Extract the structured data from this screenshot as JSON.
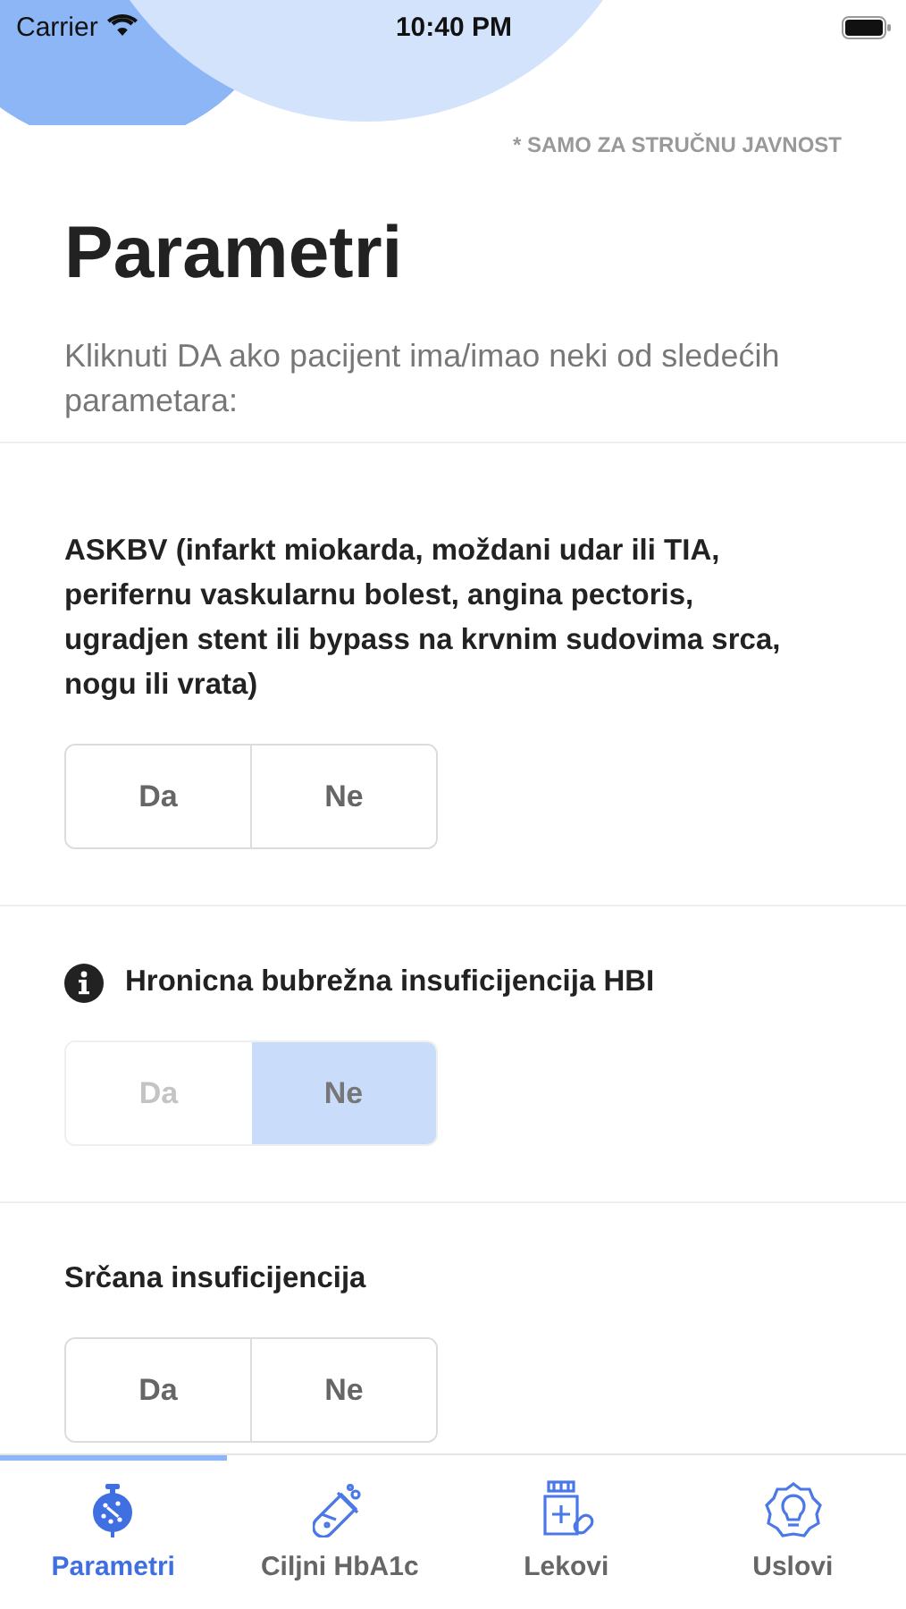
{
  "status_bar": {
    "carrier": "Carrier",
    "time": "10:40 PM"
  },
  "disclaimer": "* SAMO ZA STRUČNU JAVNOST",
  "title": "Parametri",
  "subtitle": "Kliknuti DA ako pacijent ima/imao neki od sledećih parametara:",
  "questions": [
    {
      "text": "ASKBV (infarkt miokarda, moždani udar ili TIA, perifernu vaskularnu bolest, angina pectoris, ugradjen stent ili bypass na krvnim sudovima srca, nogu ili vrata)",
      "info": false,
      "options": [
        {
          "label": "Da",
          "selected": false
        },
        {
          "label": "Ne",
          "selected": false
        }
      ]
    },
    {
      "text": "Hronicna bubrežna insuficijencija HBI",
      "info": true,
      "options": [
        {
          "label": "Da",
          "selected": false
        },
        {
          "label": "Ne",
          "selected": true
        }
      ]
    },
    {
      "text": "Srčana insuficijencija",
      "info": false,
      "options": [
        {
          "label": "Da",
          "selected": false
        },
        {
          "label": "Ne",
          "selected": false
        }
      ]
    }
  ],
  "tabs": [
    {
      "label": "Parametri",
      "kind": "stopwatch",
      "selected": true
    },
    {
      "label": "Ciljni HbA1c",
      "kind": "tube",
      "selected": false
    },
    {
      "label": "Lekovi",
      "kind": "bottle",
      "selected": false
    },
    {
      "label": "Uslovi",
      "kind": "bulb",
      "selected": false
    }
  ]
}
